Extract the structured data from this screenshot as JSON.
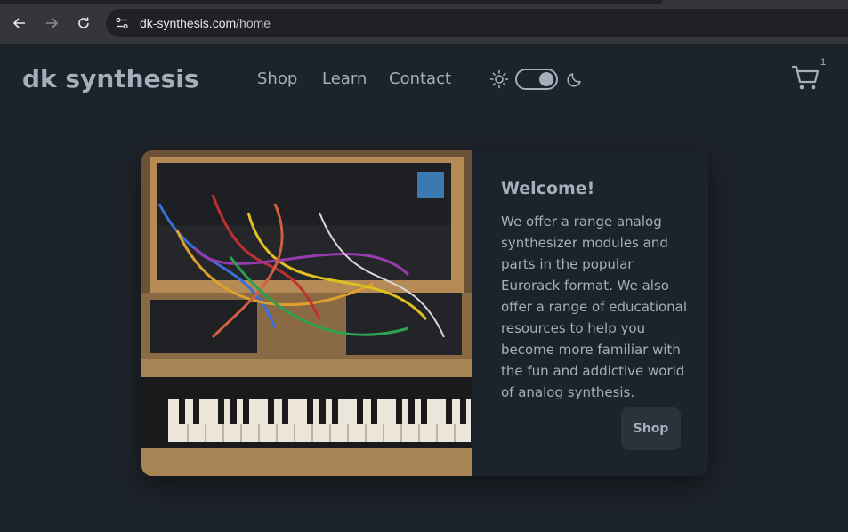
{
  "browser": {
    "url_host": "dk-synthesis.com",
    "url_path": "/home"
  },
  "site": {
    "logo": "dk synthesis",
    "nav": [
      {
        "label": "Shop"
      },
      {
        "label": "Learn"
      },
      {
        "label": "Contact"
      }
    ],
    "theme": {
      "mode": "dark"
    },
    "cart_count": "1"
  },
  "hero": {
    "title": "Welcome!",
    "text": "We offer a range analog synthesizer modules and parts in the popular Eurorack format. We also offer a range of educational resources to help you become more familiar with the fun and addictive world of analog synthesis.",
    "button_label": "Shop"
  },
  "colors": {
    "background": "#1d232a",
    "text": "#a6adbb",
    "button": "#2a323c",
    "browser_bar": "#35363a"
  }
}
